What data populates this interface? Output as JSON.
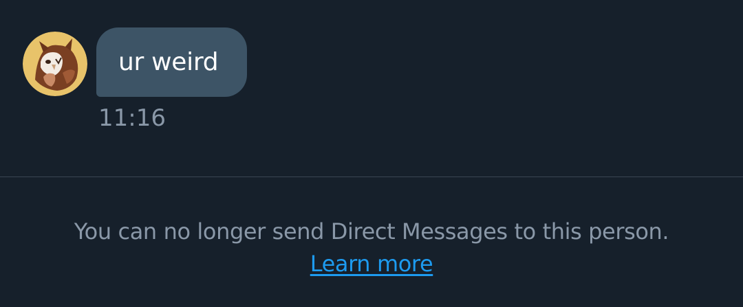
{
  "conversation": {
    "messages": [
      {
        "text": "ur weird",
        "time": "11:16",
        "avatar_icon": "owl-avatar-icon",
        "bubble_color": "#3d5466"
      }
    ]
  },
  "notice": {
    "text": "You can no longer send Direct Messages to this person.",
    "link_label": "Learn more",
    "link_color": "#1d9bf0"
  },
  "theme": {
    "background": "#16202b",
    "secondary_text": "#8a98a8"
  }
}
